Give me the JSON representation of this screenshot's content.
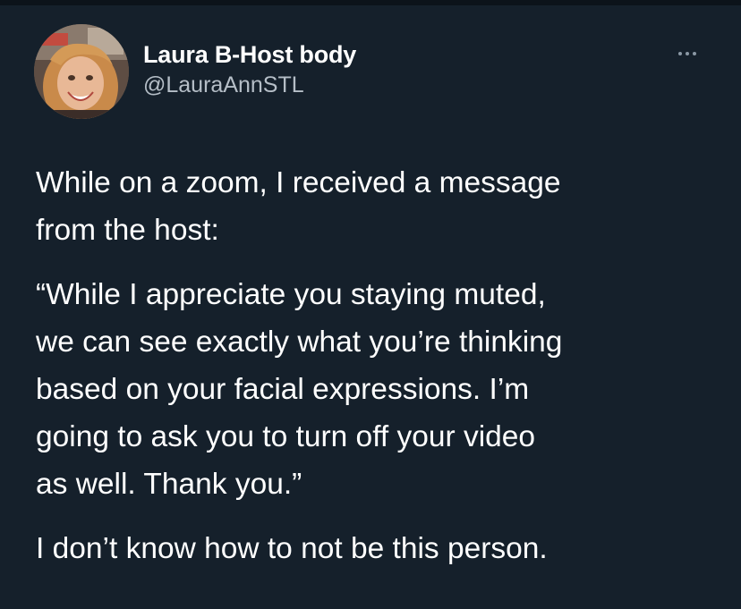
{
  "author": {
    "display_name": "Laura B-Host body",
    "handle": "@LauraAnnSTL",
    "avatar_icon": "profile-photo"
  },
  "actions": {
    "more_icon": "more-horizontal-icon"
  },
  "tweet": {
    "paragraph1": [
      "While on a zoom, I received a message",
      "from the host:"
    ],
    "paragraph2": [
      "“While I appreciate you staying muted,",
      "we can see exactly what you’re thinking",
      "based on your facial expressions. I’m",
      "going to ask you to turn off your video",
      "as well. Thank you.”"
    ],
    "paragraph3": [
      "I don’t know how to not be this person."
    ]
  },
  "colors": {
    "background": "#15202b",
    "text": "#ffffff",
    "secondary_text": "#b5bec7"
  }
}
